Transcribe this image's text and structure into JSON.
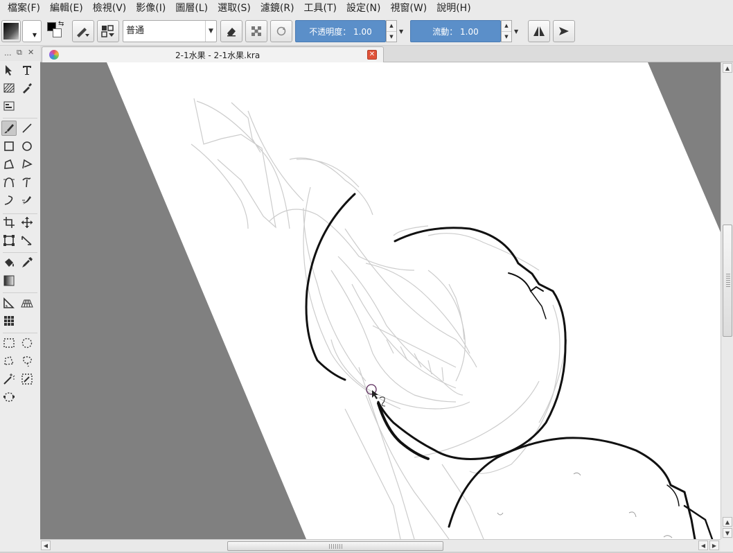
{
  "menu": [
    "檔案(F)",
    "編輯(E)",
    "檢視(V)",
    "影像(I)",
    "圖層(L)",
    "選取(S)",
    "濾鏡(R)",
    "工具(T)",
    "設定(N)",
    "視窗(W)",
    "說明(H)"
  ],
  "toolbar": {
    "blend_mode": "普通",
    "opacity": "不透明度： 1.00",
    "flow": "流動： 1.00"
  },
  "document": {
    "tab_title": "2-1水果 - 2-1水果.kra"
  },
  "dock": {
    "dots": "..."
  },
  "colors": {
    "accent": "#5b8fc9",
    "canvas_bg": "#808080",
    "close_red": "#e0533a"
  },
  "icons": {
    "tools": [
      "select-shapes",
      "text",
      "pattern",
      "calligraphy",
      "gradient-edit",
      "freehand-brush",
      "line",
      "rectangle",
      "ellipse",
      "polygon",
      "polyline",
      "bezier-curve",
      "bezier-path",
      "freehand-path",
      "dynamic-brush",
      "crop",
      "move",
      "transform",
      "measure",
      "fill",
      "color-picker",
      "gradient",
      "assistant",
      "perspective-grid",
      "grid",
      "rect-select",
      "ellipse-select",
      "polygon-select",
      "freehand-select",
      "magic-wand",
      "similar-select",
      "bezier-select"
    ]
  }
}
